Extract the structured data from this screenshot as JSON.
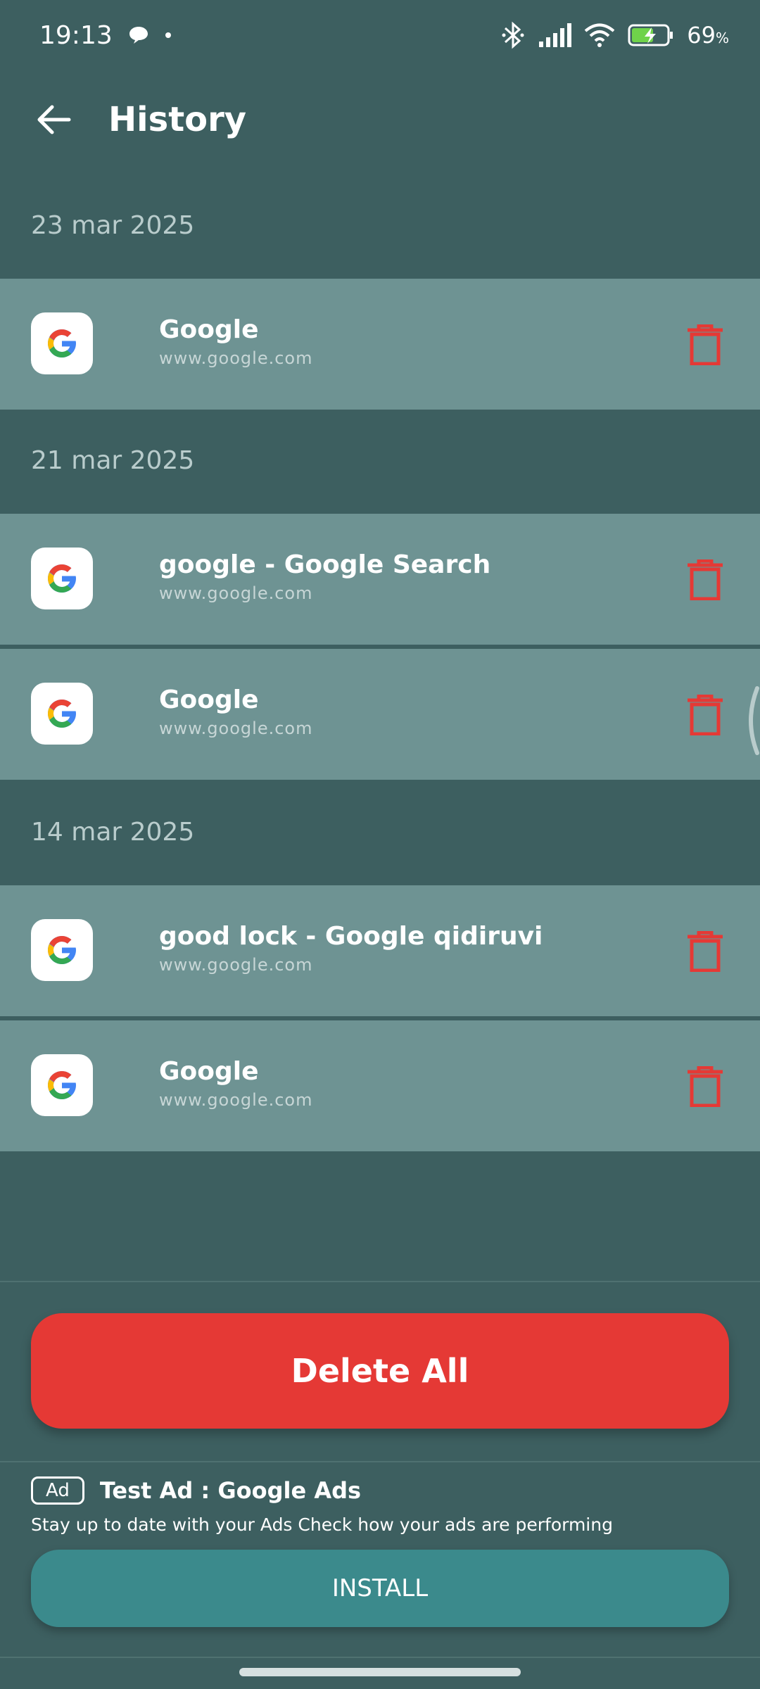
{
  "status_bar": {
    "time": "19:13",
    "battery": "69",
    "battery_unit": "%",
    "icons": [
      "chat-bubble-icon",
      "bluetooth-icon",
      "signal-icon",
      "wifi-icon",
      "battery-charging-icon"
    ]
  },
  "header": {
    "title": "History"
  },
  "history": {
    "groups": [
      {
        "date": "23 mar 2025",
        "items": [
          {
            "title": "Google",
            "url": "www.google.com"
          }
        ]
      },
      {
        "date": "21 mar 2025",
        "items": [
          {
            "title": "google - Google Search",
            "url": "www.google.com"
          },
          {
            "title": "Google",
            "url": "www.google.com"
          }
        ]
      },
      {
        "date": "14 mar 2025",
        "items": [
          {
            "title": "good lock - Google qidiruvi",
            "url": "www.google.com"
          },
          {
            "title": "Google",
            "url": "www.google.com"
          }
        ]
      }
    ]
  },
  "actions": {
    "delete_all_label": "Delete All"
  },
  "ad": {
    "badge": "Ad",
    "title": "Test Ad : Google Ads",
    "description": "Stay up to date with your Ads Check how your ads are performing",
    "install_label": "INSTALL"
  },
  "colors": {
    "background": "#3d5f60",
    "row": "#6e9393",
    "delete": "#e53935",
    "install": "#3b8a8c"
  }
}
